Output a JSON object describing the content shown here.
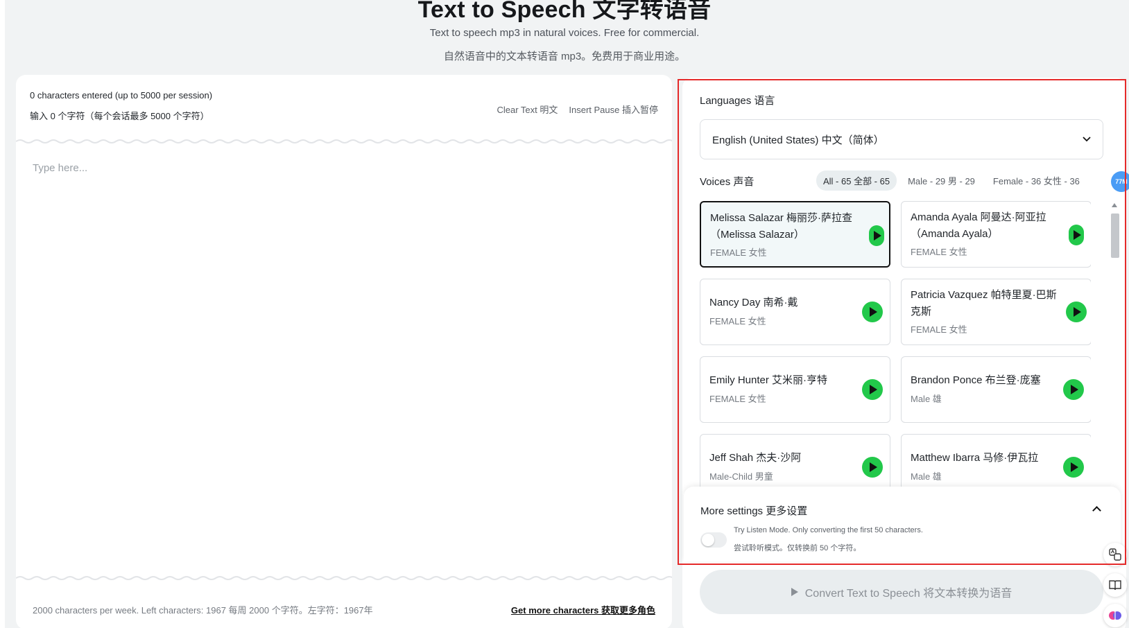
{
  "hero": {
    "title": "Text to Speech 文字转语音",
    "subtitle_en": "Text to speech mp3 in natural voices. Free for commercial.",
    "subtitle_zh": "自然语音中的文本转语音 mp3。免费用于商业用途。"
  },
  "editor": {
    "count_line1": "0 characters entered (up to 5000 per session)",
    "count_line2": "输入 0 个字符（每个会话最多 5000 个字符）",
    "clear_text": "Clear Text 明文",
    "insert_pause": "Insert Pause 插入暂停",
    "placeholder": "Type here...",
    "footer_left": "2000 characters per week. Left characters: 1967 每周 2000 个字符。左字符：1967年",
    "footer_link": "Get more characters 获取更多角色"
  },
  "settings": {
    "languages_label": "Languages 语言",
    "language_value": "English (United States) 中文（简体）",
    "voices_label": "Voices 声音",
    "filters": [
      {
        "label": "All - 65 全部 - 65",
        "active": true
      },
      {
        "label": "Male - 29 男 - 29",
        "active": false
      },
      {
        "label": "Female - 36 女性 - 36",
        "active": false
      }
    ],
    "avatar_badge": "77M",
    "voices": [
      {
        "name": "Melissa Salazar 梅丽莎·萨拉查（Melissa Salazar）",
        "gender": "FEMALE 女性",
        "selected": true
      },
      {
        "name": "Amanda Ayala 阿曼达·阿亚拉（Amanda Ayala）",
        "gender": "FEMALE 女性",
        "selected": false
      },
      {
        "name": "Nancy Day 南希·戴",
        "gender": "FEMALE 女性",
        "selected": false
      },
      {
        "name": "Patricia Vazquez 帕特里夏·巴斯克斯",
        "gender": "FEMALE 女性",
        "selected": false
      },
      {
        "name": "Emily Hunter 艾米丽·亨特",
        "gender": "FEMALE 女性",
        "selected": false
      },
      {
        "name": "Brandon Ponce 布兰登·庞塞",
        "gender": "Male 雄",
        "selected": false
      },
      {
        "name": "Jeff Shah 杰夫·沙阿",
        "gender": "Male-Child 男童",
        "selected": false
      },
      {
        "name": "Matthew Ibarra 马修·伊瓦拉",
        "gender": "Male 雄",
        "selected": false
      }
    ],
    "more_settings_label": "More settings 更多设置",
    "listen_mode_en": "Try Listen Mode. Only converting the first 50 characters.",
    "listen_mode_zh": "尝试聆听模式。仅转换前 50 个字符。",
    "convert_label": "Convert Text to Speech 将文本转换为语音"
  },
  "colors": {
    "accent_play": "#22c84a",
    "highlight": "#e52a2a",
    "badge": "#4a9cf5"
  }
}
